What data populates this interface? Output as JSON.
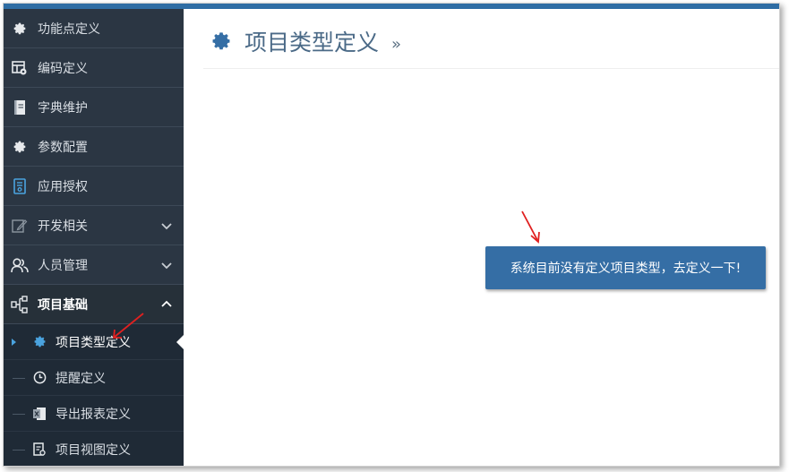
{
  "sidebar": {
    "items": [
      {
        "label": "功能点定义",
        "icon": "gear-icon"
      },
      {
        "label": "编码定义",
        "icon": "grid-gear-icon"
      },
      {
        "label": "字典维护",
        "icon": "book-icon"
      },
      {
        "label": "参数配置",
        "icon": "gear-icon"
      },
      {
        "label": "应用授权",
        "icon": "document-key-icon"
      },
      {
        "label": "开发相关",
        "icon": "edit-icon",
        "expand": "chevron-down-icon"
      },
      {
        "label": "人员管理",
        "icon": "users-icon",
        "expand": "chevron-down-icon"
      },
      {
        "label": "项目基础",
        "icon": "sitemap-icon",
        "expand": "chevron-up-icon"
      }
    ],
    "submenu": [
      {
        "label": "项目类型定义",
        "icon": "gear-icon",
        "active": true
      },
      {
        "label": "提醒定义",
        "icon": "clock-icon"
      },
      {
        "label": "导出报表定义",
        "icon": "excel-icon"
      },
      {
        "label": "项目视图定义",
        "icon": "view-icon"
      }
    ]
  },
  "main": {
    "title": "项目类型定义",
    "breadcrumb_sep": "»",
    "notice": "系统目前没有定义项目类型，去定义一下!"
  },
  "colors": {
    "sidebar_bg": "#2b3643",
    "accent": "#356ea5",
    "title": "#4b6a87",
    "annotation_arrow": "#e02020"
  }
}
